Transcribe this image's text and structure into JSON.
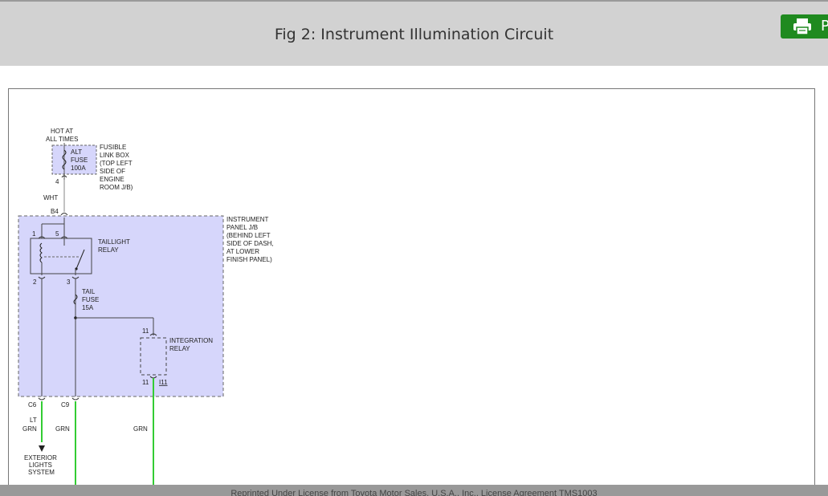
{
  "header": {
    "title": "Fig 2: Instrument Illumination Circuit",
    "print_label": "P"
  },
  "diagram": {
    "hot": [
      "HOT AT",
      "ALL TIMES"
    ],
    "alt_fuse": [
      "ALT",
      "FUSE",
      "100A"
    ],
    "fusible_box": [
      "FUSIBLE",
      "LINK BOX",
      "(TOP LEFT",
      "SIDE OF",
      "ENGINE",
      "ROOM J/B)"
    ],
    "pin_4": "4",
    "wht": "WHT",
    "b4": "B4",
    "ip_jb": [
      "INSTRUMENT",
      "PANEL J/B",
      "(BEHIND LEFT",
      "SIDE OF DASH,",
      "AT LOWER",
      "FINISH PANEL)"
    ],
    "pin_1": "1",
    "pin_5": "5",
    "taillight_relay": [
      "TAILLIGHT",
      "RELAY"
    ],
    "pin_2": "2",
    "pin_3": "3",
    "tail_fuse": [
      "TAIL",
      "FUSE",
      "15A"
    ],
    "pin_11_top": "11",
    "integration_relay": [
      "INTEGRATION",
      "RELAY"
    ],
    "pin_11_bottom": "11",
    "i11": "I11",
    "c6": "C6",
    "c9": "C9",
    "lt_grn": [
      "LT",
      "GRN"
    ],
    "grn_1": "GRN",
    "grn_2": "GRN",
    "exterior": [
      "EXTERIOR",
      "LIGHTS",
      "SYSTEM"
    ]
  },
  "footer": {
    "text": "Reprinted Under License from Toyota Motor Sales, U.S.A., Inc., License Agreement TMS1003"
  }
}
